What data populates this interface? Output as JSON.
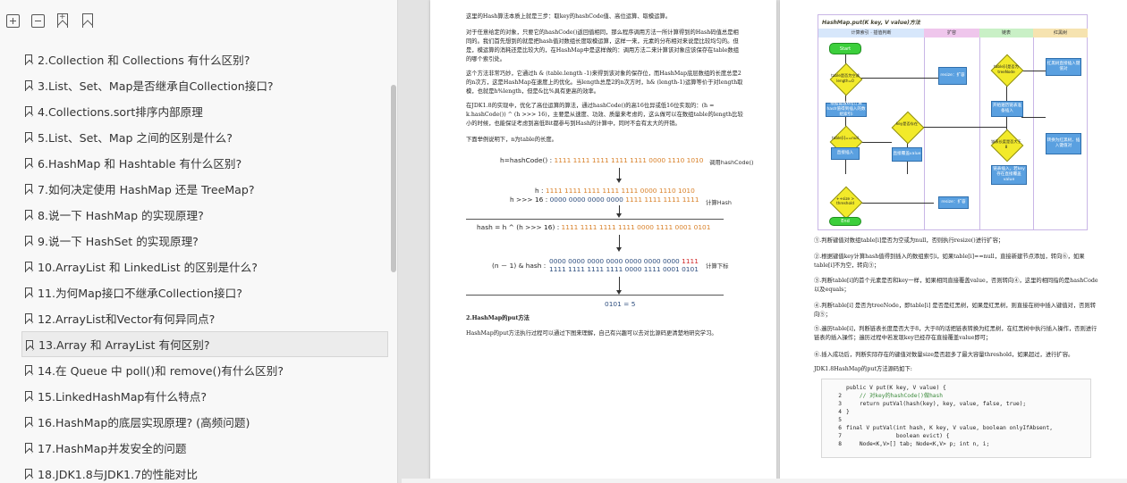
{
  "toolbar": {
    "expand_icon": "expand-all-icon",
    "collapse_icon": "collapse-all-icon",
    "add_bookmark_icon": "add-bookmark-icon",
    "bookmark_icon": "bookmark-icon"
  },
  "toc": [
    {
      "label": "2.Collection 和 Collections 有什么区别?"
    },
    {
      "label": "3.List、Set、Map是否继承自Collection接口?"
    },
    {
      "label": "4.Collections.sort排序内部原理"
    },
    {
      "label": "5.List、Set、Map 之间的区别是什么?"
    },
    {
      "label": "6.HashMap 和 Hashtable 有什么区别?"
    },
    {
      "label": "7.如何决定使用 HashMap 还是 TreeMap?"
    },
    {
      "label": "8.说一下 HashMap 的实现原理?"
    },
    {
      "label": "9.说一下 HashSet 的实现原理?"
    },
    {
      "label": "10.ArrayList 和 LinkedList 的区别是什么?"
    },
    {
      "label": "11.为何Map接口不继承Collection接口?"
    },
    {
      "label": "12.ArrayList和Vector有何异同点?"
    },
    {
      "label": "13.Array 和 ArrayList 有何区别?",
      "active": true
    },
    {
      "label": "14.在 Queue 中 poll()和 remove()有什么区别?"
    },
    {
      "label": "15.LinkedHashMap有什么特点?"
    },
    {
      "label": "16.HashMap的底层实现原理? (高频问题)"
    },
    {
      "label": "17.HashMap并发安全的问题"
    },
    {
      "label": "18.JDK1.8与JDK1.7的性能对比"
    }
  ],
  "left_page": {
    "para1": "这里的Hash算法本质上就是三步：取key的hashCode值、高位运算、取模运算。",
    "para2": "对于任意给定的对象，只要它的hashCode()返回值相同，那么程序调用方法一所计算得到的Hash码值总是相同的。我们首先想到的就是把hash值对数组长度取模运算，这样一来，元素的分布相对来说是比较均匀的。但是，模运算的消耗还是比较大的，在HashMap中是这样做的：调用方法二来计算该对象应该保存在table数组的哪个索引处。",
    "para3": "这个方法非常巧妙，它通过h & (table.length -1)来得到该对象的保存位，而HashMap底层数组的长度总是2的n次方，这是HashMap在速度上的优化。当length总是2的n次方时，h& (length-1)运算等价于对length取模，也就是h%length，但是&比%具有更高的效率。",
    "para4": "在JDK1.8的实现中，优化了高位运算的算法，通过hashCode()的高16位异或低16位实现的：(h = k.hashCode()) ^ (h >>> 16)，主要是从速度、功效、质量来考虑的，这么做可以在数组table的length比较小的时候，也能保证考虑到高低Bit都参与到Hash的计算中，同时不会有太大的开销。",
    "para5": "下面举例说明下，n为table的长度。",
    "rows": {
      "hashcode_label": "h=hashCode() :",
      "hashcode_bits": "1111 1111 1111 1111 1111 0000 1110 1010",
      "hashcode_note": "调用hashCode()",
      "h_label": "h :",
      "h_bits": "1111 1111 1111 1111 1111 0000 1110 1010",
      "shift_label": "h >>> 16 :",
      "shift_bits_a": "0000 0000 0000 0000",
      "shift_bits_b": "1111 1111 1111 1111",
      "calc_note": "计算Hash",
      "hash_label": "hash = h ^ (h >>> 16) :",
      "hash_bits": "1111 1111 1111 1111 0000 1111 0001 0101",
      "mask_label": "(n － 1) & hash :",
      "mask_bits_a": "0000 0000 0000 0000 0000 0000 0000",
      "mask_bits_a_red": "1111",
      "mask_bits_b": "1111 1111 1111 1111 0000 1111 0001 0101",
      "mod_note": "计算下标",
      "result": "0101 = 5"
    },
    "section_title": "2.HashMap的put方法",
    "section_para": "HashMap的put方法执行过程可以通过下图来理解，自己有兴趣可以去对比源码更清楚地研究学习。"
  },
  "right_page": {
    "flow_title": "HashMap.put(K key, V value)方法",
    "lanes": [
      "计算索引 · 插值判断",
      "扩容",
      "链表",
      "红黑树"
    ],
    "nodes": {
      "start": "Start",
      "table_empty": "table是否为空或length=0",
      "resize1": "resize：扩容",
      "compute_index": "根据键值key计算hash值得到插入的数组索引i",
      "table_i": "table[i]==null",
      "key_exists": "key是否存在",
      "insert": "直接插入",
      "overwrite": "直接覆盖value",
      "is_tree": "table[i]是否为treeNode",
      "tree_insert": "红黑树直接插入键值对",
      "loop_list": "开始遍历链表准备插入",
      "len_gt8": "链表长度是否大于8",
      "to_tree": "转换为红黑树，插入键值对",
      "list_insert": "链表插入，若key存在直接覆盖value",
      "size_gt": "++size > threshold",
      "resize2": "resize：扩容",
      "end": "End"
    },
    "steps": [
      "①.判断键值对数组table[i]是否为空或为null，否则执行resize()进行扩容；",
      "②.根据键值key计算hash值得到插入的数组索引i，如果table[i]==null，直接新建节点添加，转向⑥，如果table[i]不为空，转向③；",
      "③.判断table[i]的首个元素是否和key一样，如果相同直接覆盖value，否则转向④，这里的相同指的是hashCode以及equals；",
      "④.判断table[i] 是否为treeNode，即table[i] 是否是红黑树，如果是红黑树，则直接在树中插入键值对，否则转向⑤；",
      "⑤.遍历table[i]，判断链表长度是否大于8，大于8的话把链表转换为红黑树，在红黑树中执行插入操作，否则进行链表的插入操作；遍历过程中若发现key已经存在直接覆盖value即可；",
      "⑥.插入成功后，判断实际存在的键值对数量size是否超多了最大容量threshold，如果超过，进行扩容。"
    ],
    "code_caption": "JDK1.8HashMap的put方法源码如下:",
    "code": [
      {
        "n": "",
        "t": "public V put(K key, V value) {"
      },
      {
        "n": "2",
        "t": "    // 对key的hashCode()做hash"
      },
      {
        "n": "3",
        "t": "    return putVal(hash(key), key, value, false, true);"
      },
      {
        "n": "4",
        "t": "}"
      },
      {
        "n": "5",
        "t": ""
      },
      {
        "n": "6",
        "t": "final V putVal(int hash, K key, V value, boolean onlyIfAbsent,"
      },
      {
        "n": "7",
        "t": "               boolean evict) {"
      },
      {
        "n": "8",
        "t": "    Node<K,V>[] tab; Node<K,V> p; int n, i;"
      }
    ]
  }
}
